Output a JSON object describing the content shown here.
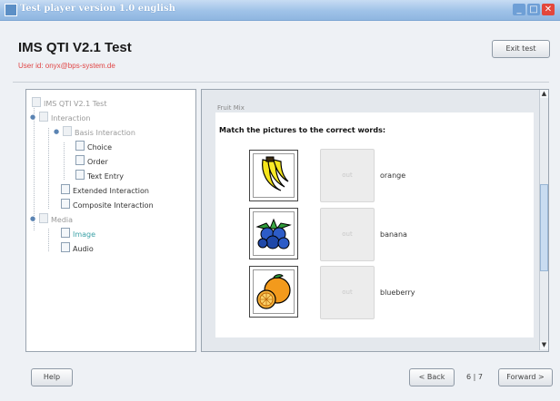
{
  "window": {
    "title": "Test player version 1.0 english"
  },
  "header": {
    "title": "IMS QTI V2.1 Test",
    "user_id": "User id: onyx@bps-system.de",
    "exit_label": "Exit test"
  },
  "tree": {
    "root": "IMS QTI V2.1 Test",
    "interaction": "Interaction",
    "basis": "Basis Interaction",
    "choice": "Choice",
    "order": "Order",
    "text_entry": "Text Entry",
    "extended": "Extended Interaction",
    "composite": "Composite Interaction",
    "media": "Media",
    "image": "Image",
    "audio": "Audio"
  },
  "content": {
    "section_label": "Fruit Mix",
    "prompt": "Match the pictures to the correct words:",
    "items": [
      {
        "icon": "banana-icon",
        "slot": "out",
        "word": "orange"
      },
      {
        "icon": "blueberry-icon",
        "slot": "out",
        "word": "banana"
      },
      {
        "icon": "orange-icon",
        "slot": "out",
        "word": "blueberry"
      }
    ]
  },
  "footer": {
    "help_label": "Help",
    "back_label": "< Back",
    "page": "6 | 7",
    "forward_label": "Forward >"
  },
  "colors": {
    "accent": "#3aa1a6",
    "user_id": "#e04646",
    "titlebar": "#9fc2e8"
  }
}
